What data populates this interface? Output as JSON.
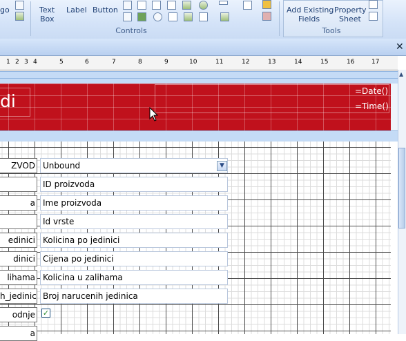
{
  "ribbon": {
    "cut_label": "go",
    "controls_group": {
      "label": "Controls",
      "text_box": [
        "Text",
        "Box"
      ],
      "label_btn": "Label",
      "button_btn": "Button"
    },
    "tools_group": {
      "label": "Tools",
      "add_existing": [
        "Add Existing",
        "Fields"
      ],
      "property_sheet": [
        "Property",
        "Sheet"
      ]
    }
  },
  "ruler": {
    "numbers": [
      "1",
      "2",
      "3",
      "4",
      "5",
      "6",
      "7",
      "8",
      "9",
      "10",
      "11",
      "12",
      "13",
      "14",
      "15",
      "16",
      "17"
    ]
  },
  "report_header": {
    "title_fragment": "di",
    "date_expr": "=Date()",
    "time_expr": "=Time()"
  },
  "detail": {
    "labels": [
      "ZVOD",
      "",
      "a",
      "",
      "edinici",
      "dinici",
      "lihama",
      "h_jedinica",
      "odnje",
      "a"
    ],
    "combo_value": "Unbound",
    "fields": [
      "ID proizvoda",
      "Ime proizvoda",
      "Id vrste",
      "Kolicina po jedinici",
      "Cijena po jedinici",
      "Kolicina u zalihama",
      "Broj narucenih jedinica"
    ],
    "checkbox_checked": true
  },
  "colors": {
    "header_band": "#c0111c",
    "ribbon_text": "#1e3f74",
    "section_bar": "#c4dbf6"
  }
}
